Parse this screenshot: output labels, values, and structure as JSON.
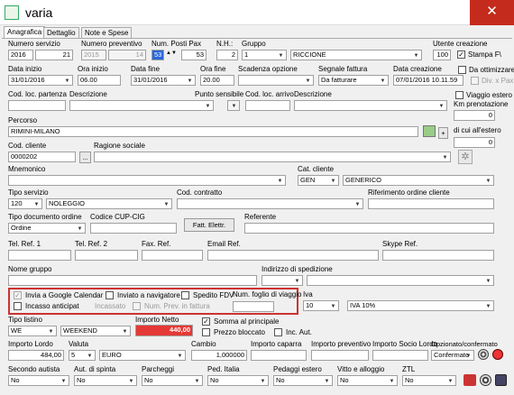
{
  "window": {
    "title": "varia",
    "close": "✕"
  },
  "tabs": [
    "Anagrafica",
    "Dettaglio",
    "Note e Spese"
  ],
  "labels": {
    "numero_servizio": "Numero servizio",
    "numero_preventivo": "Numero preventivo",
    "num_posti_pax": "Num. Posti Pax",
    "nh": "N.H.:",
    "gruppo": "Gruppo",
    "utente_creazione": "Utente creazione",
    "stampa_fv": "Stampa F\\",
    "data_inizio": "Data inizio",
    "ora_inizio": "Ora inizio",
    "data_fine": "Data fine",
    "ora_fine": "Ora fine",
    "scadenza_opzione": "Scadenza opzione",
    "segnale_fattura": "Segnale fattura",
    "data_creazione": "Data creazione",
    "da_ottimizzare": "Da ottimizzare",
    "div_x_pax": "Div. x Pax",
    "cod_loc_partenza": "Cod. loc. partenza",
    "descrizione": "Descrizione",
    "punto_sensibile": "Punto sensibile",
    "cod_loc_arrivo": "Cod. loc. arrivo",
    "descrizione2": "Descrizione",
    "viaggio_estero": "Viaggio estero",
    "km_prenotazione": "Km prenotazione",
    "percorso": "Percorso",
    "di_cui_estero": "di cui all'estero",
    "cod_cliente": "Cod. cliente",
    "ragione_sociale": "Ragione sociale",
    "mnemonico": "Mnemonico",
    "cat_cliente": "Cat. cliente",
    "tipo_servizio": "Tipo servizio",
    "cod_contratto": "Cod. contratto",
    "rif_ordine_cliente": "Riferimento ordine cliente",
    "tipo_documento_ordine": "Tipo documento ordine",
    "codice_cup_cig": "Codice CUP-CIG",
    "fatt_elettr": "Fatt. Elettr.",
    "referente": "Referente",
    "tel_ref1": "Tel. Ref. 1",
    "tel_ref2": "Tel. Ref. 2",
    "fax_ref": "Fax. Ref.",
    "email_ref": "Email Ref.",
    "skype_ref": "Skype Ref.",
    "nome_gruppo": "Nome gruppo",
    "indirizzo_spedizione": "Indirizzo di spedizione",
    "invia_google": "Invia a Google Calendar",
    "inviato_navigatore": "Inviato a navigatore",
    "spedito_fdv": "Spedito FDV",
    "num_foglio_viaggio": "Num. foglio di viaggio",
    "incasso_anticipat": "Incasso anticipat",
    "incassato": "Incassato",
    "num_prev_fattura": "Num. Prev. in fattura",
    "iva": "Iva",
    "tipo_listino": "Tipo listino",
    "importo_netto": "Importo Netto",
    "somma_principale": "Somma al principale",
    "prezzo_bloccato": "Prezzo bloccato",
    "inc_aut": "Inc. Aut.",
    "importo_lordo": "Importo Lordo",
    "valuta": "Valuta",
    "cambio": "Cambio",
    "importo_caparra": "Importo caparra",
    "importo_preventivo": "Importo preventivo",
    "importo_socio": "Importo Socio Lordo",
    "opzionato": "Opzionato/confermato",
    "secondo_autista": "Secondo autista",
    "aut_spinta": "Aut. di spinta",
    "parcheggi": "Parcheggi",
    "ped_italia": "Ped. Italia",
    "pedaggi_estero": "Pedaggi estero",
    "vitto_alloggio": "Vitto e alloggio",
    "ztl": "ZTL"
  },
  "values": {
    "numero_servizio_anno": "2016",
    "numero_servizio": "21",
    "preventivo_anno": "2015",
    "preventivo_num": "14",
    "posti": "53",
    "pax": "53",
    "nh": "2",
    "gruppo_cod": "1",
    "gruppo_desc": "RICCIONE",
    "utente": "100",
    "data_inizio": "31/01/2016",
    "ora_inizio": "06.00",
    "data_fine": "31/01/2016",
    "ora_fine": "20.00",
    "segnale_fattura": "Da fatturare",
    "data_creazione": "07/01/2016 10.11.59",
    "km": "0",
    "percorso": "RIMINI-MILANO",
    "di_cui_estero": "0",
    "cod_cliente": "0000202",
    "btn_dots": "...",
    "cat_cod": "GEN",
    "cat_desc": "GENERICO",
    "tipo_servizio_cod": "120",
    "tipo_servizio_desc": "NOLEGGIO",
    "tipo_documento": "Ordine",
    "iva_cod": "10",
    "iva_desc": "IVA 10%",
    "listino_cod": "WE",
    "listino_desc": "WEEKEND",
    "importo_netto": "440,00",
    "importo_lordo": "484,00",
    "valuta_cod": "5",
    "valuta_desc": "EURO",
    "cambio": "1,000000",
    "opzionato": "Confermato",
    "no": "No",
    "plus": "+"
  }
}
